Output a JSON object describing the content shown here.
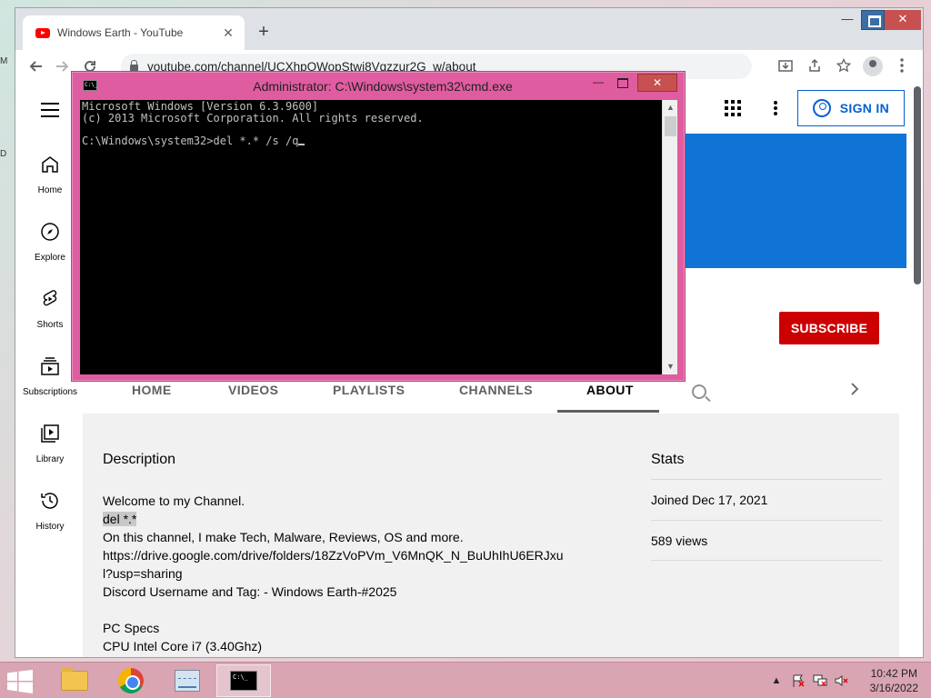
{
  "browser": {
    "tab_title": "Windows Earth - YouTube",
    "tab_close": "✕",
    "new_tab": "+",
    "url": "youtube.com/channel/UCXhpOWopStwi8Vqzzur2G_w/about",
    "window_controls": {
      "minimize": "—",
      "close": "✕"
    }
  },
  "yt": {
    "sign_in_label": "SIGN IN",
    "subscribe_label": "SUBSCRIBE",
    "sidebar": [
      {
        "label": "Home",
        "icon": "home-icon"
      },
      {
        "label": "Explore",
        "icon": "compass-icon"
      },
      {
        "label": "Shorts",
        "icon": "shorts-icon"
      },
      {
        "label": "Subscriptions",
        "icon": "subscriptions-icon"
      },
      {
        "label": "Library",
        "icon": "library-icon"
      },
      {
        "label": "History",
        "icon": "history-icon"
      }
    ],
    "channel_tabs": [
      "HOME",
      "VIDEOS",
      "PLAYLISTS",
      "CHANNELS",
      "ABOUT"
    ],
    "active_tab": "ABOUT",
    "about": {
      "description_title": "Description",
      "description_lines": [
        "Welcome to my Channel.",
        "del *.*",
        "On this channel, I make Tech, Malware, Reviews, OS and more.",
        "https://drive.google.com/drive/folders/18ZzVoPVm_V6MnQK_N_BuUhIhU6ERJxu",
        "l?usp=sharing",
        "Discord Username and Tag: - Windows Earth-#2025",
        "",
        "PC Specs",
        "CPU Intel Core i7 (3.40Ghz)"
      ],
      "stats_title": "Stats",
      "stats": [
        "Joined Dec 17, 2021",
        "589 views"
      ]
    },
    "colors": {
      "banner": "#0f74d6",
      "subscribe": "#cc0000",
      "sign_in": "#065fd4"
    }
  },
  "cmd": {
    "title": "Administrator: C:\\Windows\\system32\\cmd.exe",
    "icon_text": "C:\\_",
    "lines": [
      "Microsoft Windows [Version 6.3.9600]",
      "(c) 2013 Microsoft Corporation. All rights reserved.",
      "",
      "C:\\Windows\\system32>del *.* /s /q"
    ],
    "controls": {
      "minimize": "—",
      "close": "✕"
    },
    "scroll_up": "▲",
    "scroll_down": "▼",
    "frame_color": "#e05ca0"
  },
  "taskbar": {
    "apps": [
      {
        "name": "file-explorer",
        "active": false
      },
      {
        "name": "chrome",
        "active": false
      },
      {
        "name": "performance-monitor",
        "active": false
      },
      {
        "name": "command-prompt",
        "active": true
      }
    ],
    "tray_caret": "▲",
    "time": "10:42 PM",
    "date": "3/16/2022"
  }
}
